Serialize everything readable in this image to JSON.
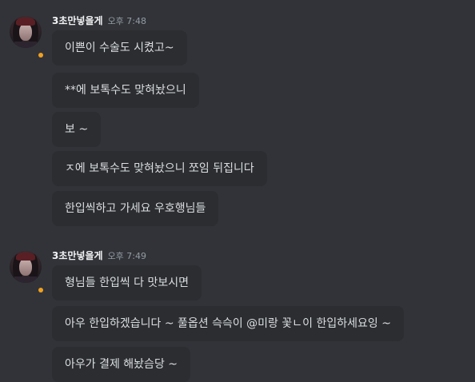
{
  "groups": [
    {
      "username": "3초만넣을게",
      "timestamp": "오후 7:48",
      "avatar_icon": "user-avatar-icon",
      "status_color": "#f0a020",
      "messages": [
        "이쁜이 수술도 시켰고~",
        "**에 보톡수도 맞혀놨으니",
        "보 ~",
        "ㅈ에 보톡수도 맞혀놨으니 쪼임 뒤집니다",
        "한입씩하고 가세요 우호행님들"
      ]
    },
    {
      "username": "3초만넣을게",
      "timestamp": "오후 7:49",
      "avatar_icon": "user-avatar-icon",
      "status_color": "#f0a020",
      "messages": [
        "형님들 한입씩 다 맛보시면",
        "아우 한입하겠습니다 ~ 풀옵션 슥슥이 @미랑 꽃ㄴ이 한입하세요잉 ~",
        "아우가 결제 해놨슴당 ~"
      ]
    }
  ],
  "colors": {
    "background": "#313338",
    "bubble": "#2b2d31",
    "text": "#dbdee1",
    "username": "#f2f3f5",
    "timestamp": "#949ba4"
  }
}
